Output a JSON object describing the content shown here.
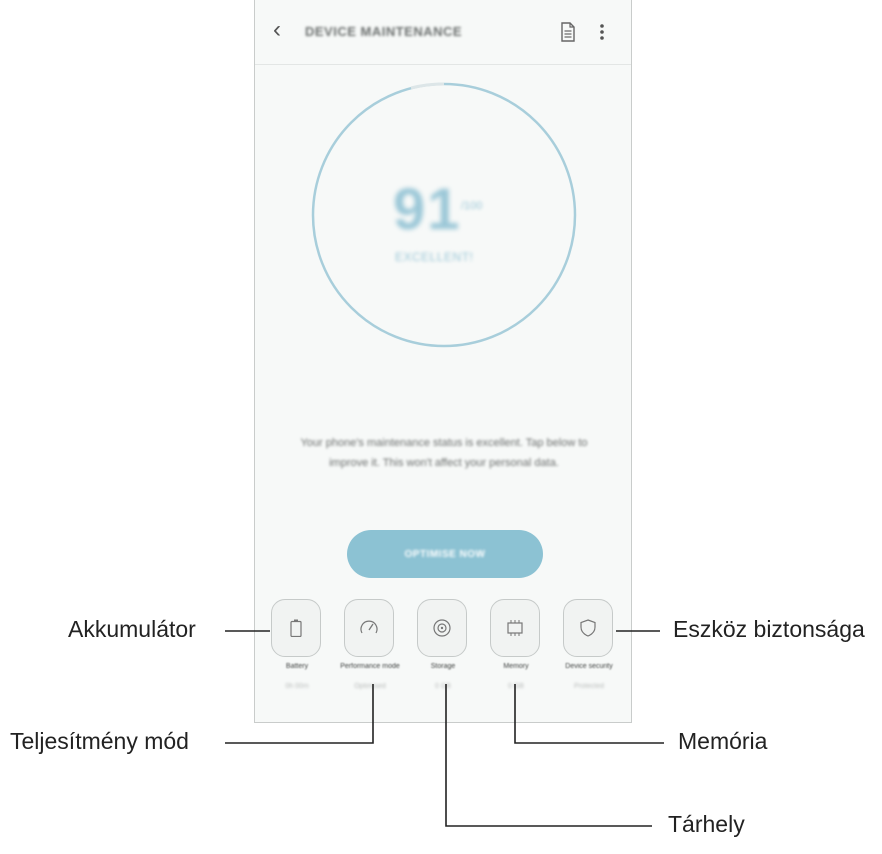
{
  "app_bar": {
    "title": "DEVICE MAINTENANCE",
    "back_icon": "back-arrow-icon",
    "report_icon": "document-icon",
    "more_icon": "more-options-icon"
  },
  "score": {
    "value": "91",
    "max_label": "/100",
    "status": "EXCELLENT!"
  },
  "description": "Your phone's maintenance status is excellent. Tap below to improve it. This won't affect your personal data.",
  "optimize_button": "OPTIMISE NOW",
  "features": [
    {
      "label": "Battery",
      "value": "0h 00m",
      "icon": "battery-icon"
    },
    {
      "label": "Performance mode",
      "value": "Optimised",
      "icon": "speedometer-icon"
    },
    {
      "label": "Storage",
      "value": "0 GB",
      "icon": "storage-icon"
    },
    {
      "label": "Memory",
      "value": "0 GB",
      "icon": "memory-chip-icon"
    },
    {
      "label": "Device security",
      "value": "Protected",
      "icon": "shield-icon"
    }
  ],
  "callouts": {
    "battery": "Akkumulátor",
    "performance": "Teljesítmény mód",
    "storage": "Tárhely",
    "memory": "Memória",
    "security": "Eszköz biztonsága"
  },
  "colors": {
    "accent": "#8cc2d3",
    "ring": "#a8cedb",
    "background": "#f7f9f8"
  }
}
